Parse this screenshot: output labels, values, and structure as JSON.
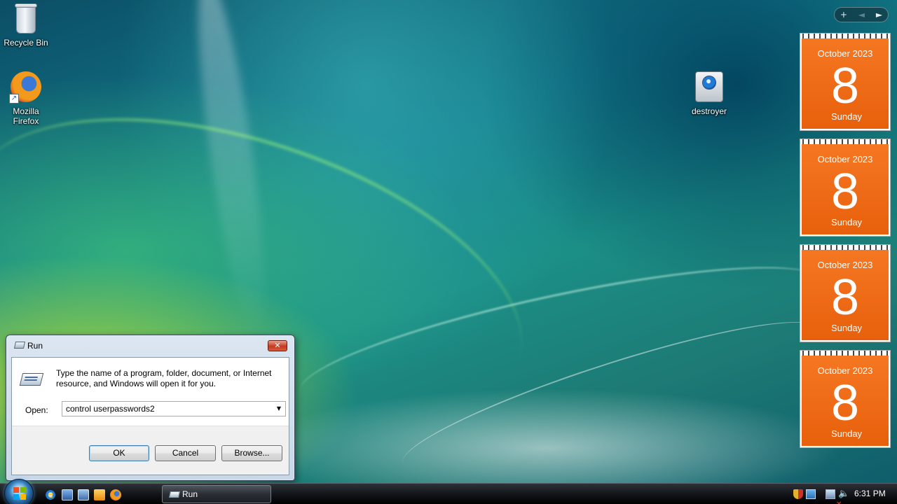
{
  "desktop": {
    "icons": [
      {
        "label": "Recycle Bin",
        "icon": "recycle-bin-icon"
      },
      {
        "label": "Mozilla\nFirefox",
        "icon": "firefox-icon"
      },
      {
        "label": "destroyer",
        "icon": "destroyer-icon"
      }
    ]
  },
  "sidebar": {
    "add": "+",
    "prev": "◄",
    "next": "►",
    "calendars": [
      {
        "month": "October 2023",
        "day": "8",
        "weekday": "Sunday"
      },
      {
        "month": "October 2023",
        "day": "8",
        "weekday": "Sunday"
      },
      {
        "month": "October 2023",
        "day": "8",
        "weekday": "Sunday"
      },
      {
        "month": "October 2023",
        "day": "8",
        "weekday": "Sunday"
      }
    ]
  },
  "run_dialog": {
    "title": "Run",
    "close": "✕",
    "description": "Type the name of a program, folder, document, or Internet resource, and Windows will open it for you.",
    "open_label": "Open:",
    "open_value": "control userpasswords2",
    "dropdown_arrow": "▼",
    "ok_label": "OK",
    "cancel_label": "Cancel",
    "browse_label": "Browse..."
  },
  "taskbar": {
    "quick_launch": [
      "internet-explorer-icon",
      "show-desktop-icon",
      "switch-windows-icon",
      "media-player-icon",
      "firefox-icon"
    ],
    "task_run_label": "Run",
    "clock": "6:31 PM"
  },
  "colors": {
    "calendar_orange": "#ef6a15",
    "taskbar": "#15181c"
  }
}
